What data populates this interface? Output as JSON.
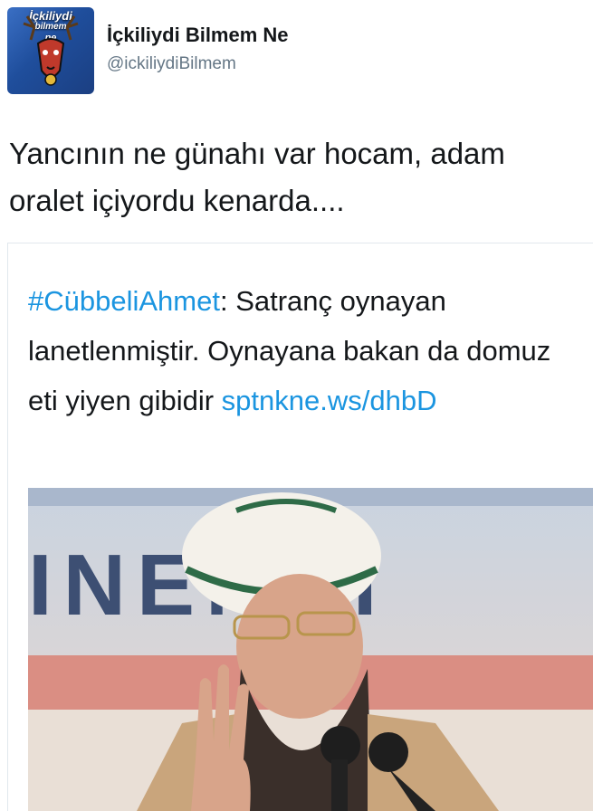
{
  "account": {
    "display_name": "İçkiliydi Bilmem Ne",
    "handle": "@ickiliydiBilmem",
    "avatar_text": [
      "İçkiliydi",
      "bilmem",
      "ne"
    ]
  },
  "tweet": {
    "text": "Yancının ne günahı var hocam, adam oralet içiyordu kenarda...."
  },
  "quoted": {
    "hashtag": "#CübbeliAhmet",
    "text": ": Satranç oynayan lanetlenmiştir. Oynayana bakan da domuz eti yiyen gibidir ",
    "link": "sptnkne.ws/dhbD",
    "banner_text": "INENKI"
  },
  "colors": {
    "link": "#1b95e0",
    "text": "#14171a",
    "muted": "#657786"
  }
}
